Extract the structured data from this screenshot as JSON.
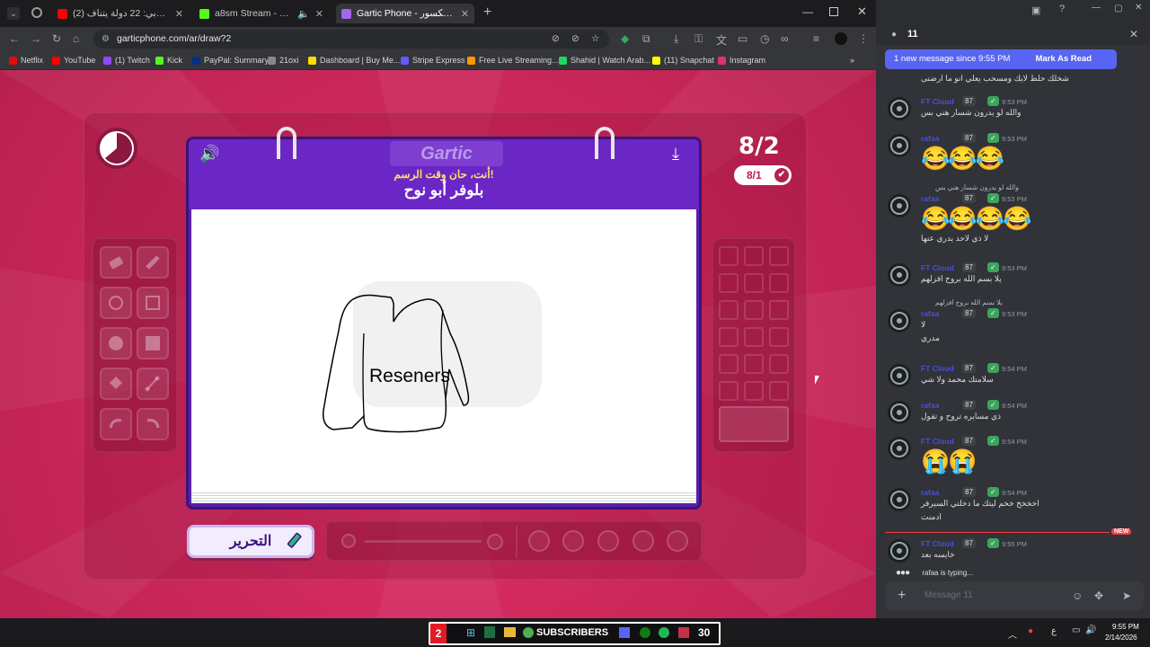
{
  "browser": {
    "tabs": [
      {
        "title": "(2) أكبر تحدي عربي: 22 دولة يتناف...",
        "active": false,
        "color": "#ff0000"
      },
      {
        "title": "a8sm Stream - Watch Live o...",
        "active": false,
        "color": "#53fc18"
      },
      {
        "title": "Gartic Phone - الهاتف المكسور",
        "active": true,
        "color": "#a367e8"
      }
    ],
    "url": "garticphone.com/ar/draw?2",
    "bookmarks": [
      "Netflix",
      "YouTube",
      "(1) Twitch",
      "Kick",
      "PayPal: Summary",
      "21oxi",
      "Dashboard | Buy Me...",
      "Stripe Express",
      "Free Live Streaming...",
      "Shahid | Watch Arab...",
      "(11) Snapchat",
      "Instagram"
    ],
    "bookmark_colors": [
      "#e50914",
      "#ff0000",
      "#9146ff",
      "#53fc18",
      "#003087",
      "#888888",
      "#ffdd00",
      "#635bff",
      "#ff9800",
      "#1ed760",
      "#fffc00",
      "#e1306c"
    ]
  },
  "game": {
    "logo": "Gartic",
    "instruction": "أنت، حان وقت الرسم!",
    "phrase": "بلوفر أبو نوح",
    "round": "8/2",
    "done_count": "8/1",
    "done_button": "التحرير",
    "drawing_text": "Reseners"
  },
  "discord": {
    "channel_count": "11",
    "new_message_banner": "1 new message since 9:55 PM",
    "mark_as_read": "Mark As Read",
    "top_text": "شخلك حلط لايك ومسحب يعلي انو ما ارضنى",
    "messages": [
      {
        "user": "FT Cloud",
        "tag": "87",
        "time": "9:53 PM",
        "text": "والله لو يدرون شسار هني بس",
        "emoji": ""
      },
      {
        "user": "rafaa",
        "tag": "87",
        "time": "9:53 PM",
        "text": "",
        "emoji": "😂😂😂"
      },
      {
        "user": "rafaa",
        "tag": "87",
        "time": "9:53 PM",
        "reply": "والله لو يدرون شسار هني بس",
        "text": "لا ذي لاحد يدري عنها",
        "emoji": "😂😂😂😂"
      },
      {
        "user": "FT Cloud",
        "tag": "87",
        "time": "9:53 PM",
        "text": "يلا بسم الله بروح افزلهم",
        "emoji": ""
      },
      {
        "user": "rafaa",
        "tag": "87",
        "time": "9:53 PM",
        "reply": "يلا بسم الله بروح افزلهم",
        "text": "لا",
        "text2": "مدري",
        "emoji": ""
      },
      {
        "user": "FT Cloud",
        "tag": "87",
        "time": "9:54 PM",
        "text": "سلامتك محمد ولا شي",
        "emoji": ""
      },
      {
        "user": "rafaa",
        "tag": "87",
        "time": "9:54 PM",
        "text": "ذي مسايره تروح و تقول",
        "emoji": ""
      },
      {
        "user": "FT Cloud",
        "tag": "87",
        "time": "9:54 PM",
        "text": "",
        "emoji": "😭😭"
      },
      {
        "user": "rafaa",
        "tag": "87",
        "time": "9:54 PM",
        "text": "اخخخخ خخم ليتك ما دخلتي السيرفر",
        "text2": "ادمنت",
        "emoji": ""
      },
      {
        "user": "FT Cloud",
        "tag": "87",
        "time": "9:55 PM",
        "text": "خايسه بعد",
        "emoji": ""
      }
    ],
    "new_label": "NEW",
    "typing": "rafaa is typing...",
    "input_placeholder": "Message 11"
  },
  "taskbar": {
    "left_badge": "2",
    "subscribers": "SUBSCRIBERS",
    "sub_count": "30",
    "lang": "ع",
    "time": "9:55 PM",
    "date": "2/14/2026"
  }
}
